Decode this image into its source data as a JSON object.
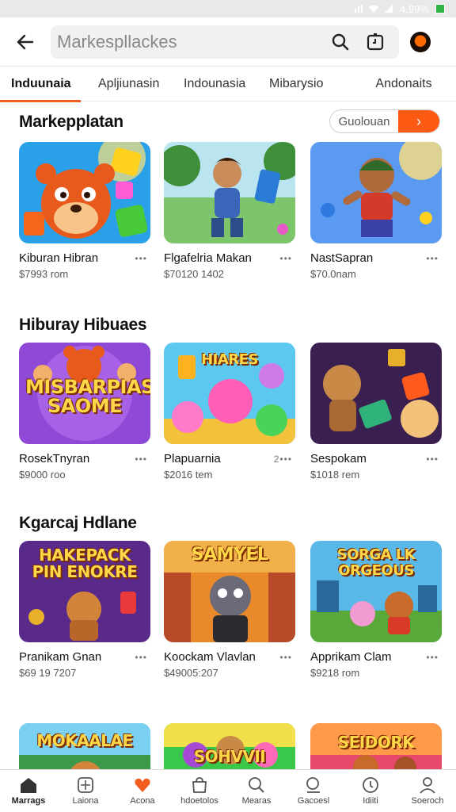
{
  "status_bar": {
    "battery_text": "4.99%"
  },
  "header": {
    "back_icon": "arrow-left-icon",
    "search_placeholder": "Markespllackes",
    "icons": [
      "search-icon",
      "timer-icon",
      "profile-avatar"
    ]
  },
  "tabs": [
    {
      "label": "Induunaia",
      "active": true
    },
    {
      "label": "Apljiunasin",
      "active": false
    },
    {
      "label": "Indounasia",
      "active": false
    },
    {
      "label": "Mibarysio",
      "active": false
    },
    {
      "label": "Andonaits",
      "active": false
    }
  ],
  "sections": [
    {
      "title": "Markepplatan",
      "see_all_label": "Guolouan",
      "items": [
        {
          "name": "Kiburan Hibran",
          "price": "$7993 rom",
          "more": "•••"
        },
        {
          "name": "Flgafelria Makan",
          "price": "$70120 1402",
          "more": "•••"
        },
        {
          "name": "NastSapran",
          "price": "$70.0nam",
          "more": "•••"
        }
      ]
    },
    {
      "title": "Hiburay Hibuaes",
      "items": [
        {
          "name": "RosekTnyran",
          "price": "$9000 roo",
          "more": "•••",
          "art_text": "MISBARPIAS SAOME"
        },
        {
          "name": "Plapuarnia",
          "price": "$2016 tem",
          "more": "2•••",
          "art_text": "HIARES"
        },
        {
          "name": "Sespokam",
          "price": "$1018 rem",
          "more": "•••"
        }
      ]
    },
    {
      "title": "Kgarcaj Hdlane",
      "items": [
        {
          "name": "Pranikam Gnan",
          "price": "$69 19 7207",
          "more": "•••",
          "art_text": "HAKEPACK PIN ENOKRE"
        },
        {
          "name": "Koockam Vlavlan",
          "price": "$49005:207",
          "more": "•••",
          "art_text": "SAMYEL"
        },
        {
          "name": "Apprikam Clam",
          "price": "$9218 rom",
          "more": "•••",
          "art_text": "SORGA LK ORGEOUS"
        }
      ]
    },
    {
      "items": [
        {
          "art_text": "MOKAALAE"
        },
        {
          "art_text": "SOHVVII"
        },
        {
          "art_text": "SEIDORK"
        }
      ]
    }
  ],
  "bottom_nav": [
    {
      "label": "Marrags",
      "icon": "home-icon",
      "active": true
    },
    {
      "label": "Laiona",
      "icon": "grid-icon",
      "active": false
    },
    {
      "label": "Acona",
      "icon": "heart-icon",
      "active": false
    },
    {
      "label": "hdoetolos",
      "icon": "bag-icon",
      "active": false
    },
    {
      "label": "Mearas",
      "icon": "search-icon",
      "active": false
    },
    {
      "label": "Gacoesl",
      "icon": "lens-icon",
      "active": false
    },
    {
      "label": "Idiiti",
      "icon": "info-icon",
      "active": false
    },
    {
      "label": "Soeroch",
      "icon": "user-icon",
      "active": false
    }
  ]
}
